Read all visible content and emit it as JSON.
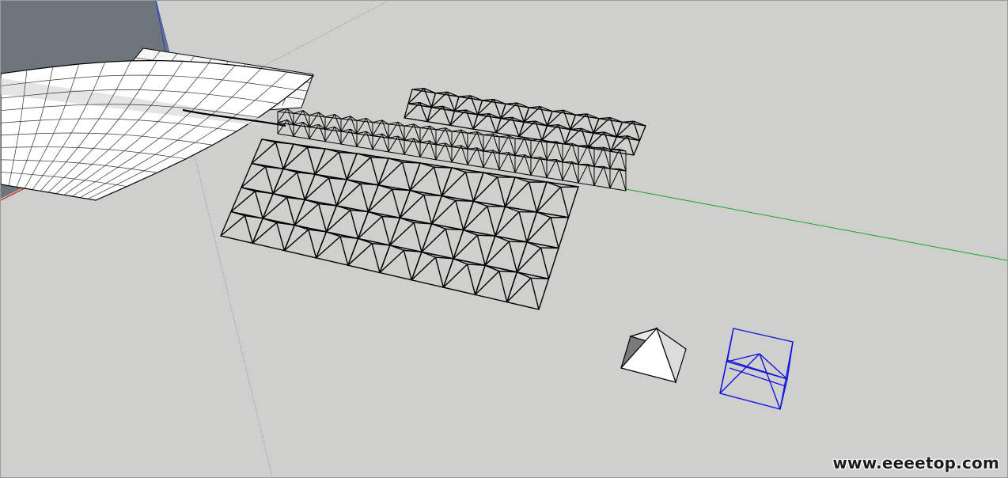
{
  "app": {
    "watermark": "www.eeeetop.com"
  },
  "colors": {
    "viewport_background": "#cfcfcd",
    "green_axis": "#1fa51f",
    "red_axis": "#d23a2a",
    "blue_axis": "#2a3ac8",
    "selection": "#1414e0",
    "edge": "#000000",
    "face": "#ffffff",
    "wall": "#6d767d"
  },
  "scene": {
    "objects": [
      {
        "id": "wall",
        "kind": "shaded-solid"
      },
      {
        "id": "curved-sheet",
        "kind": "curved-surface"
      },
      {
        "id": "pyramid-array",
        "kind": "wireframe-array"
      },
      {
        "id": "pyramid-solid",
        "kind": "shaded-solid"
      },
      {
        "id": "pyramid-component",
        "kind": "selected-component"
      }
    ]
  }
}
